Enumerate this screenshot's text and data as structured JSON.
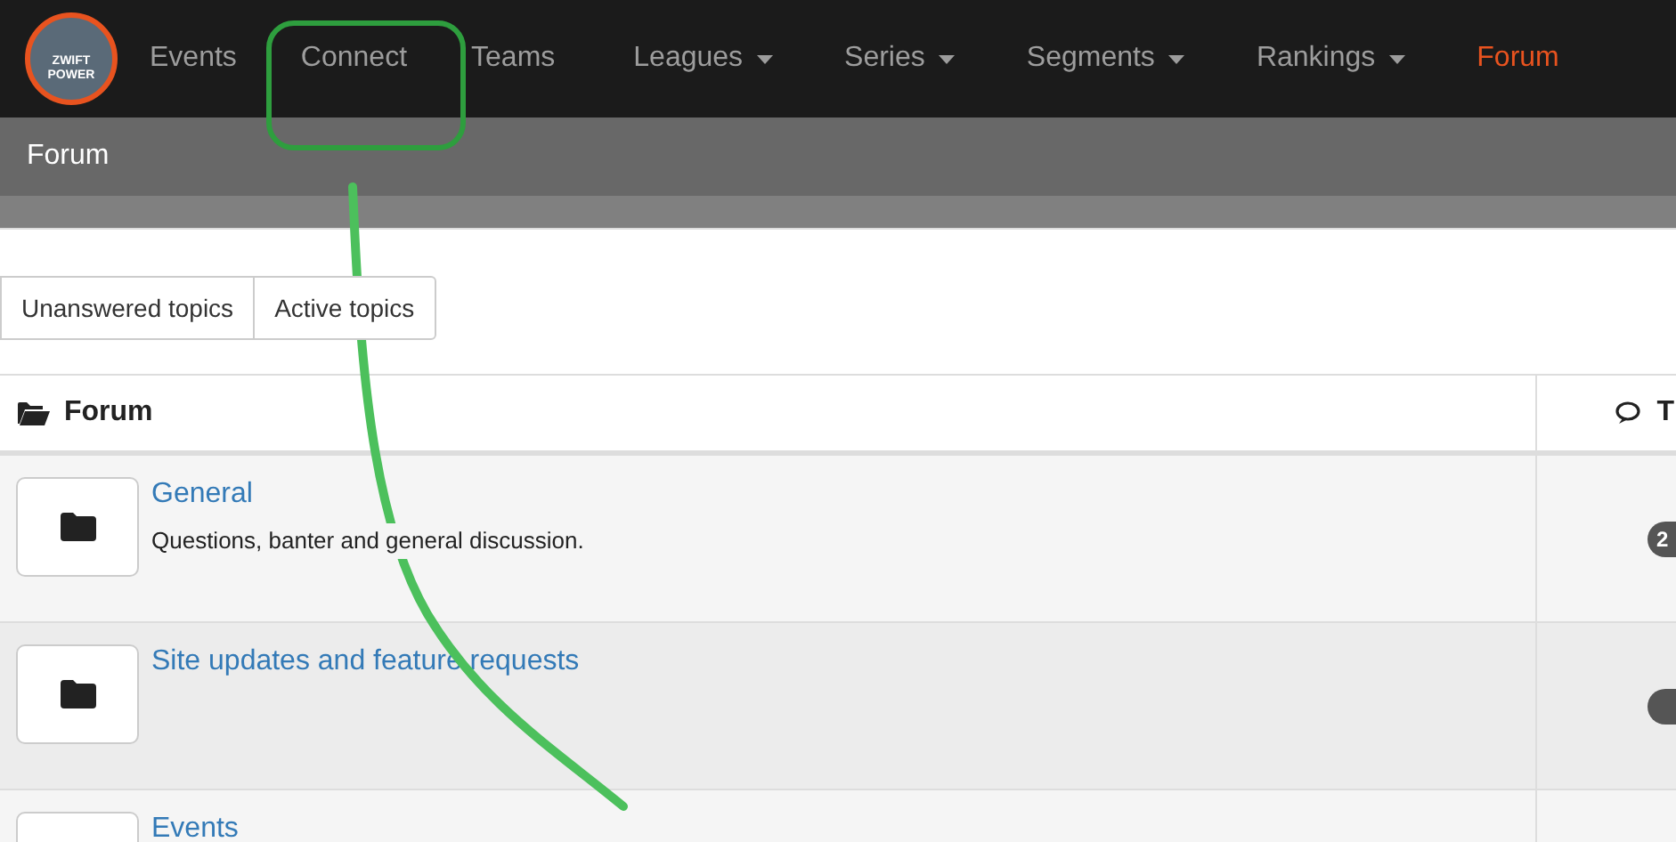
{
  "logo": {
    "lines": [
      "ZWIFT",
      "POWER"
    ]
  },
  "nav": {
    "items": [
      {
        "label": "Events",
        "dropdown": false,
        "selected": false
      },
      {
        "label": "Connect",
        "dropdown": false,
        "selected": false
      },
      {
        "label": "Teams",
        "dropdown": false,
        "selected": false
      },
      {
        "label": "Leagues",
        "dropdown": true,
        "selected": false
      },
      {
        "label": "Series",
        "dropdown": true,
        "selected": false
      },
      {
        "label": "Segments",
        "dropdown": true,
        "selected": false
      },
      {
        "label": "Rankings",
        "dropdown": true,
        "selected": false
      },
      {
        "label": "Forum",
        "dropdown": false,
        "selected": true
      }
    ]
  },
  "page_title": "Forum",
  "topic_buttons": [
    "Unanswered topics",
    "Active topics"
  ],
  "table": {
    "columns": [
      "Forum",
      "T"
    ],
    "rows": [
      {
        "title": "General",
        "description": "Questions, banter and general discussion.",
        "badge": "2"
      },
      {
        "title": "Site updates and feature requests",
        "badge": ""
      },
      {
        "title": "Events"
      }
    ]
  }
}
